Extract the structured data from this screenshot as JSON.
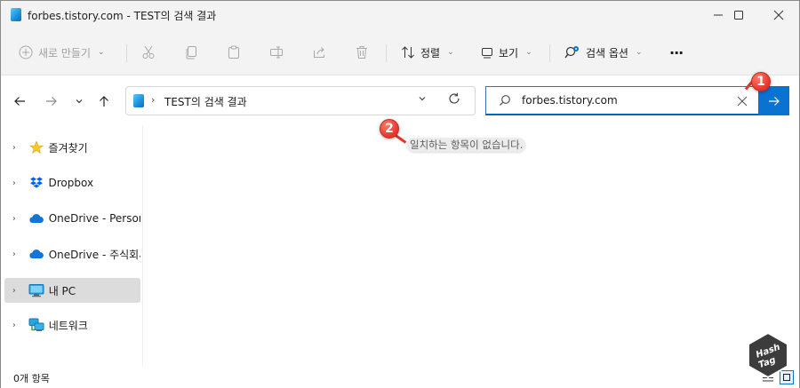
{
  "window": {
    "title": "forbes.tistory.com - TEST의 검색 결과"
  },
  "toolbar": {
    "new_label": "새로 만들기",
    "sort_label": "정렬",
    "view_label": "보기",
    "search_options_label": "검색 옵션",
    "more_label": "···"
  },
  "address": {
    "path": "TEST의 검색 결과"
  },
  "search": {
    "query": "forbes.tistory.com"
  },
  "sidebar": {
    "items": [
      {
        "label": "즐겨찾기",
        "icon": "star-icon"
      },
      {
        "label": "Dropbox",
        "icon": "dropbox-icon"
      },
      {
        "label": "OneDrive - Persona",
        "icon": "onedrive-cloud-icon"
      },
      {
        "label": "OneDrive - 주식회사",
        "icon": "onedrive-cloud-icon"
      },
      {
        "label": "내 PC",
        "icon": "monitor-icon",
        "selected": true
      },
      {
        "label": "네트워크",
        "icon": "network-icon"
      }
    ]
  },
  "content": {
    "empty_message": "일치하는 항목이 없습니다."
  },
  "annotations": {
    "badge_1": "1",
    "badge_2": "2"
  },
  "status": {
    "item_count": "0개 항목"
  },
  "logo": {
    "text_line1": "Hash",
    "text_line2": "Tag"
  },
  "colors": {
    "accent": "#0a72d1",
    "badge": "#e3352a",
    "selected_bg": "#dcdcdc",
    "chrome_bg": "#f3f3f3"
  }
}
